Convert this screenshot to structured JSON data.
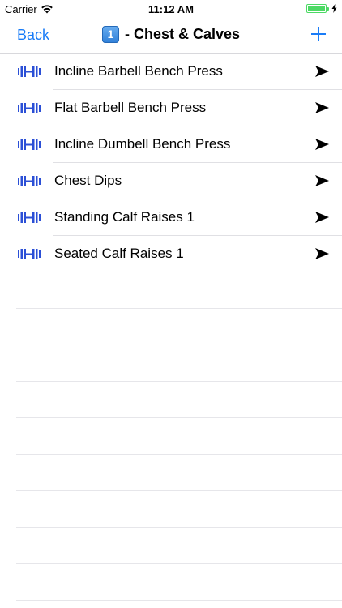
{
  "status_bar": {
    "carrier": "Carrier",
    "time": "11:12 AM",
    "battery_level": 1.0
  },
  "nav": {
    "back_label": "Back",
    "keycap": "1",
    "title": "- Chest & Calves",
    "add_icon": "plus-icon"
  },
  "colors": {
    "accent": "#1a7cf7",
    "battery": "#4cd964",
    "separator": "#e0e0e4"
  },
  "exercises": [
    {
      "label": "Incline Barbell Bench Press",
      "icon": "dumbbell-icon",
      "accessory": "arrow-right-icon"
    },
    {
      "label": "Flat Barbell Bench Press",
      "icon": "dumbbell-icon",
      "accessory": "arrow-right-icon"
    },
    {
      "label": "Incline Dumbell Bench Press",
      "icon": "dumbbell-icon",
      "accessory": "arrow-right-icon"
    },
    {
      "label": "Chest Dips",
      "icon": "dumbbell-icon",
      "accessory": "arrow-right-icon"
    },
    {
      "label": "Standing Calf Raises 1",
      "icon": "dumbbell-icon",
      "accessory": "arrow-right-icon"
    },
    {
      "label": "Seated Calf Raises 1",
      "icon": "dumbbell-icon",
      "accessory": "arrow-right-icon"
    }
  ]
}
